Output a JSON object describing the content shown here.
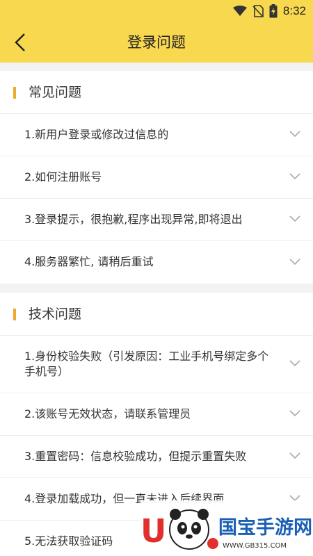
{
  "status": {
    "time": "8:32"
  },
  "header": {
    "title": "登录问题"
  },
  "sections": [
    {
      "title": "常见问题",
      "items": [
        "1.新用户登录或修改过信息的",
        "2.如何注册账号",
        "3.登录提示，很抱歉,程序出现异常,即将退出",
        "4.服务器繁忙, 请稍后重试"
      ]
    },
    {
      "title": "技术问题",
      "items": [
        "1.身份校验失败（引发原因：工业手机号绑定多个手机号）",
        "2.该账号无效状态，请联系管理员",
        "3.重置密码：信息校验成功，但提示重置失败",
        "4.登录加载成功，但一直未进入后续界面",
        "5.无法获取验证码"
      ]
    }
  ],
  "watermark": {
    "site": "国宝手游网",
    "url": "WWW.GB315.COM"
  },
  "colors": {
    "accent": "#f8d84f",
    "section_bar": "#f0a830"
  }
}
